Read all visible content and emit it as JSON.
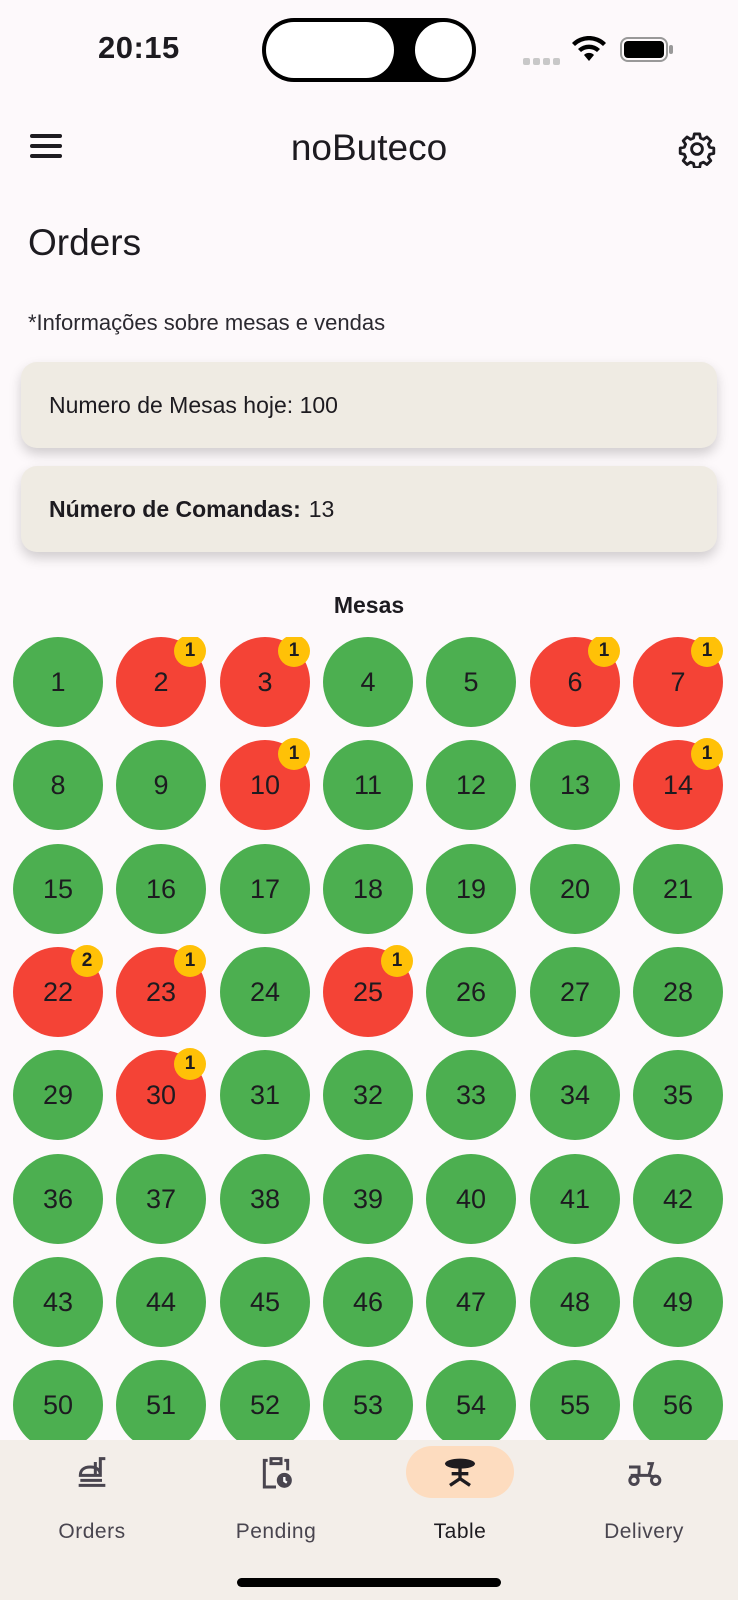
{
  "status_bar": {
    "time": "20:15"
  },
  "app_bar": {
    "title": "noButeco"
  },
  "page": {
    "title": "Orders",
    "subtitle": "*Informações sobre mesas e vendas"
  },
  "cards": {
    "mesas_hoje": "Numero de Mesas hoje: 100",
    "comandas_label": "Número de Comandas:",
    "comandas_value": "13"
  },
  "grid": {
    "title": "Mesas",
    "colors": {
      "free": "#4caf50",
      "busy": "#f44336",
      "badge": "#ffc107"
    },
    "tables": [
      {
        "n": "1"
      },
      {
        "n": "2",
        "badge": "1"
      },
      {
        "n": "3",
        "badge": "1"
      },
      {
        "n": "4"
      },
      {
        "n": "5"
      },
      {
        "n": "6",
        "badge": "1"
      },
      {
        "n": "7",
        "badge": "1"
      },
      {
        "n": "8"
      },
      {
        "n": "9"
      },
      {
        "n": "10",
        "badge": "1"
      },
      {
        "n": "11"
      },
      {
        "n": "12"
      },
      {
        "n": "13"
      },
      {
        "n": "14",
        "badge": "1"
      },
      {
        "n": "15"
      },
      {
        "n": "16"
      },
      {
        "n": "17"
      },
      {
        "n": "18"
      },
      {
        "n": "19"
      },
      {
        "n": "20"
      },
      {
        "n": "21"
      },
      {
        "n": "22",
        "badge": "2"
      },
      {
        "n": "23",
        "badge": "1"
      },
      {
        "n": "24"
      },
      {
        "n": "25",
        "badge": "1"
      },
      {
        "n": "26"
      },
      {
        "n": "27"
      },
      {
        "n": "28"
      },
      {
        "n": "29"
      },
      {
        "n": "30",
        "badge": "1"
      },
      {
        "n": "31"
      },
      {
        "n": "32"
      },
      {
        "n": "33"
      },
      {
        "n": "34"
      },
      {
        "n": "35"
      },
      {
        "n": "36"
      },
      {
        "n": "37"
      },
      {
        "n": "38"
      },
      {
        "n": "39"
      },
      {
        "n": "40"
      },
      {
        "n": "41"
      },
      {
        "n": "42"
      },
      {
        "n": "43"
      },
      {
        "n": "44"
      },
      {
        "n": "45"
      },
      {
        "n": "46"
      },
      {
        "n": "47"
      },
      {
        "n": "48"
      },
      {
        "n": "49"
      },
      {
        "n": "50"
      },
      {
        "n": "51"
      },
      {
        "n": "52"
      },
      {
        "n": "53"
      },
      {
        "n": "54"
      },
      {
        "n": "55"
      },
      {
        "n": "56"
      }
    ]
  },
  "bottom_nav": {
    "items": [
      {
        "label": "Orders",
        "icon": "food-tray-icon",
        "active": false
      },
      {
        "label": "Pending",
        "icon": "clipboard-clock-icon",
        "active": false
      },
      {
        "label": "Table",
        "icon": "table-restaurant-icon",
        "active": true
      },
      {
        "label": "Delivery",
        "icon": "scooter-icon",
        "active": false
      }
    ]
  }
}
